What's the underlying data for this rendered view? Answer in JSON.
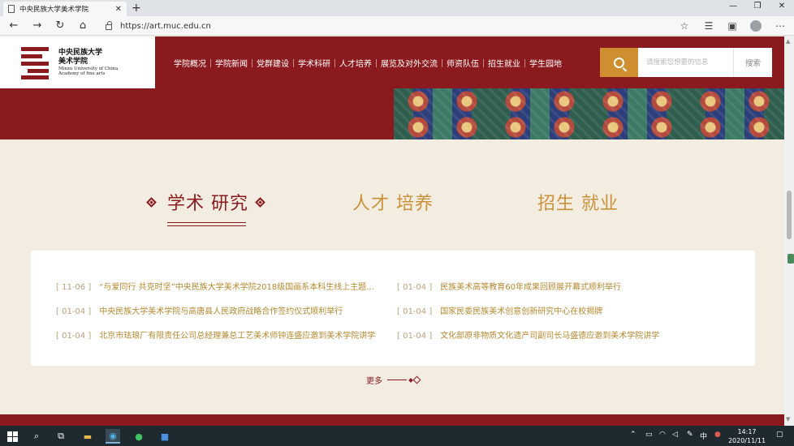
{
  "browser": {
    "tab_title": "中央民族大学美术学院",
    "tab_close": "✕",
    "new_tab": "+",
    "url": "https://art.muc.edu.cn",
    "window_controls": [
      "—",
      "❐",
      "✕"
    ],
    "toolbar_icons": [
      "star-icon",
      "favorites-icon",
      "collections-icon",
      "profile-icon",
      "more-icon"
    ]
  },
  "site": {
    "logo_cn_line1": "中央民族大学",
    "logo_cn_line2": "美术学院",
    "logo_en_line1": "Minzu University of China",
    "logo_en_line2": "Academy of fine arts",
    "nav": [
      "学院概况",
      "学院新闻",
      "党群建设",
      "学术科研",
      "人才培养",
      "展览及对外交流",
      "师资队伍",
      "招生就业",
      "学生园地"
    ],
    "search_placeholder": "请搜索您想要的信息",
    "search_button": "搜索"
  },
  "section_tabs": [
    {
      "label": "学术 研究",
      "active": true
    },
    {
      "label": "人才 培养",
      "active": false
    },
    {
      "label": "招生 就业",
      "active": false
    }
  ],
  "news": [
    {
      "date": "[ 11-06 ]",
      "title": "“与爱同行 共克时坚”中央民族大学美术学院2018级国画系本科生线上主题..."
    },
    {
      "date": "[ 01-04 ]",
      "title": "民族美术高等教育60年成果回顾展开幕式顺利举行"
    },
    {
      "date": "[ 01-04 ]",
      "title": "中央民族大学美术学院与高唐县人民政府战略合作签约仪式顺利举行"
    },
    {
      "date": "[ 01-04 ]",
      "title": "国家民委民族美术创意创新研究中心在校揭牌"
    },
    {
      "date": "[ 01-04 ]",
      "title": "北京市珐琅厂有限责任公司总经理兼总工艺美术师钟连盛应邀到美术学院讲学"
    },
    {
      "date": "[ 01-04 ]",
      "title": "文化部原非物质文化遗产司副司长马盛德应邀到美术学院讲学"
    }
  ],
  "more_label": "更多",
  "taskbar": {
    "tray_ime": "中",
    "time": "14:17",
    "date": "2020/11/11"
  }
}
